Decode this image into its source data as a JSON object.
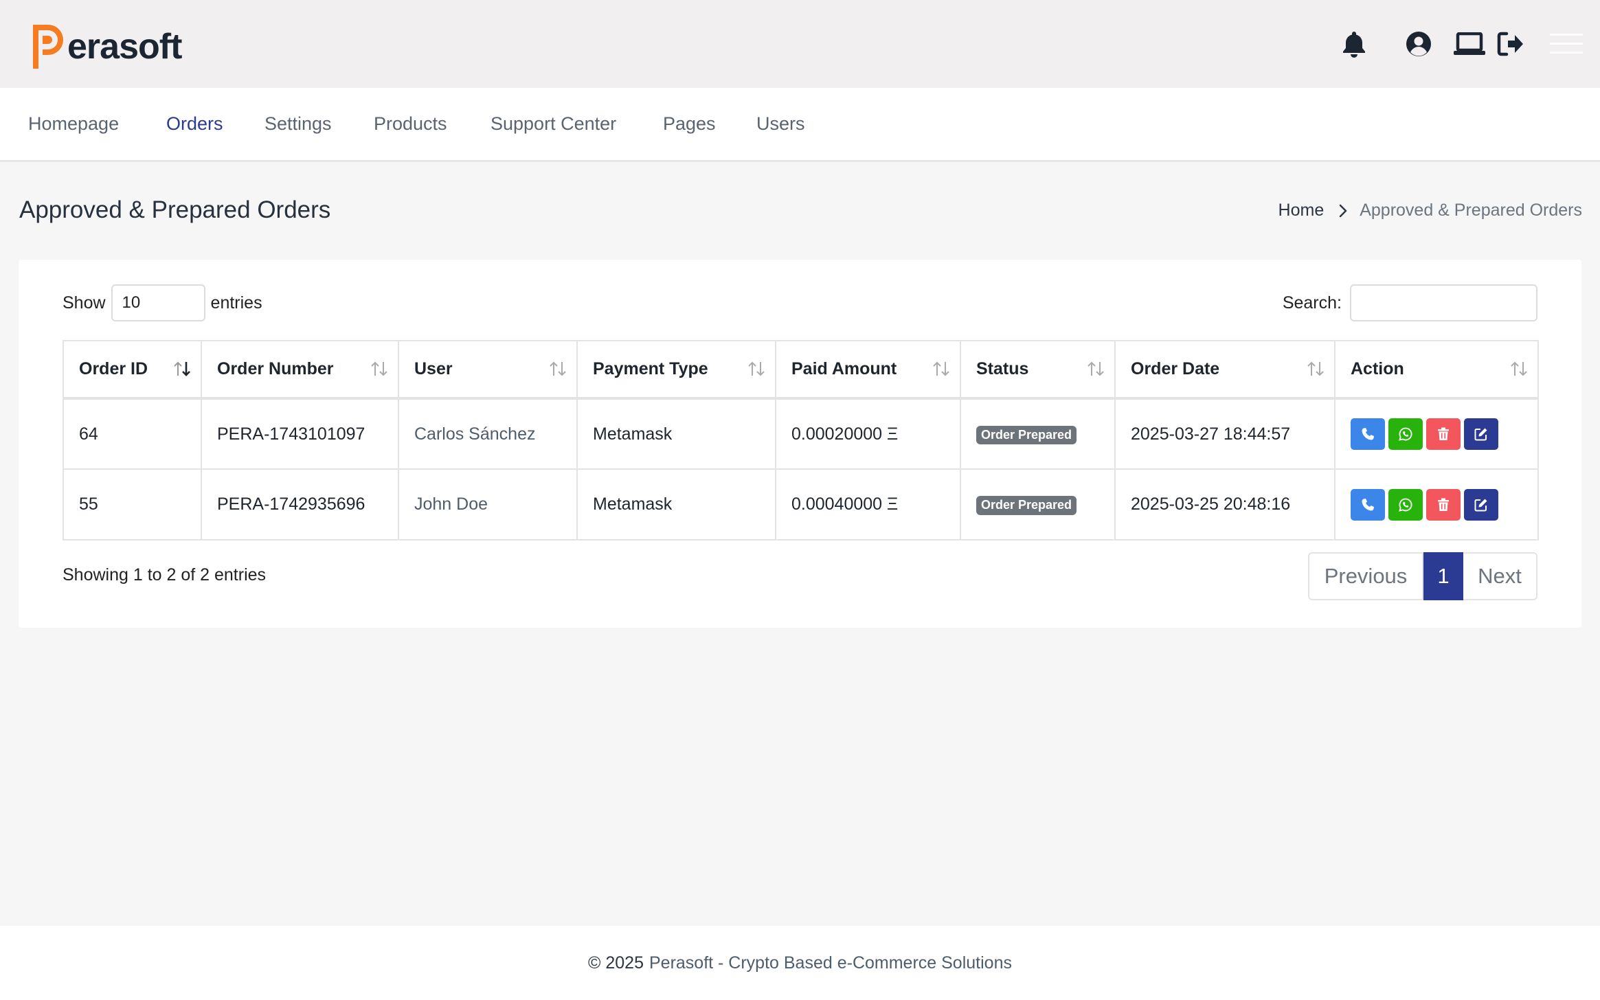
{
  "app": {
    "logo_text": "erasoft",
    "brand_color": "#f57c20"
  },
  "header": {
    "icons": [
      "bell-icon",
      "user-circle-icon",
      "laptop-icon",
      "logout-icon",
      "hamburger-menu-icon"
    ]
  },
  "nav": {
    "items": [
      {
        "label": "Homepage",
        "active": false
      },
      {
        "label": "Orders",
        "active": true
      },
      {
        "label": "Settings",
        "active": false
      },
      {
        "label": "Products",
        "active": false
      },
      {
        "label": "Support Center",
        "active": false
      },
      {
        "label": "Pages",
        "active": false
      },
      {
        "label": "Users",
        "active": false
      }
    ]
  },
  "page": {
    "title": "Approved & Prepared Orders",
    "breadcrumb": {
      "home": "Home",
      "current": "Approved & Prepared Orders"
    }
  },
  "table_controls": {
    "show_label": "Show",
    "entries_label": "entries",
    "page_length": "10",
    "search_label": "Search:",
    "search_value": ""
  },
  "table": {
    "columns": [
      "Order ID",
      "Order Number",
      "User",
      "Payment Type",
      "Paid Amount",
      "Status",
      "Order Date",
      "Action"
    ],
    "rows": [
      {
        "order_id": "64",
        "order_number": "PERA-1743101097",
        "user": "Carlos Sánchez",
        "payment_type": "Metamask",
        "paid_amount": "0.00020000 Ξ",
        "status": "Order Prepared",
        "order_date": "2025-03-27 18:44:57"
      },
      {
        "order_id": "55",
        "order_number": "PERA-1742935696",
        "user": "John Doe",
        "payment_type": "Metamask",
        "paid_amount": "0.00040000 Ξ",
        "status": "Order Prepared",
        "order_date": "2025-03-25 20:48:16"
      }
    ],
    "action_icons": [
      "phone-icon",
      "whatsapp-icon",
      "trash-icon",
      "edit-icon"
    ]
  },
  "pagination": {
    "info": "Showing 1 to 2 of 2 entries",
    "previous": "Previous",
    "current": "1",
    "next": "Next"
  },
  "footer": {
    "copyright": "© 2025",
    "brand": "Perasoft - Crypto Based e-Commerce Solutions"
  },
  "colors": {
    "primary": "#2b3a93",
    "call": "#3b86e8",
    "whatsapp": "#28b30c",
    "delete": "#f3565d",
    "badge": "#6c737b"
  }
}
